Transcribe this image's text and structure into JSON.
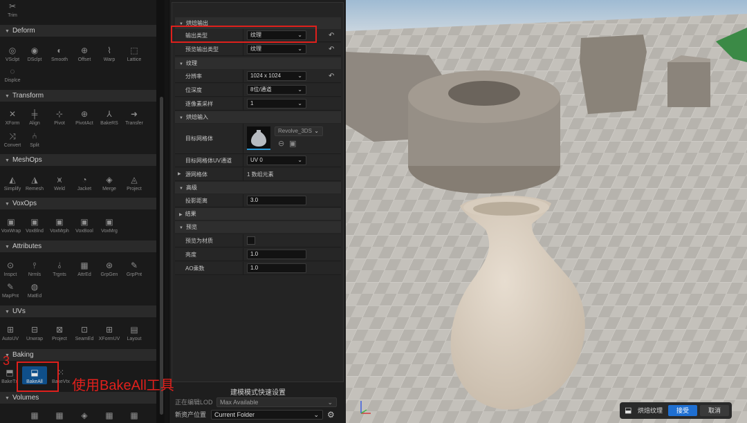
{
  "palette": {
    "sections": [
      {
        "title": "Deform",
        "tools": [
          "VSclpt",
          "DSclpt",
          "Smooth",
          "Offset",
          "Warp",
          "Lattice",
          "Displce"
        ]
      },
      {
        "title": "Transform",
        "tools": [
          "XForm",
          "Align",
          "Pivot",
          "PivotAct",
          "BakeRS",
          "Transfer",
          "Convert",
          "Split"
        ]
      },
      {
        "title": "MeshOps",
        "tools": [
          "Simplify",
          "Remesh",
          "Weld",
          "Jacket",
          "Merge",
          "Project"
        ]
      },
      {
        "title": "VoxOps",
        "tools": [
          "VoxWrap",
          "VoxBlnd",
          "VoxMrph",
          "VoxBool",
          "VoxMrg"
        ]
      },
      {
        "title": "Attributes",
        "tools": [
          "Inspct",
          "Nrmls",
          "Trgnts",
          "AttrEd",
          "GrpGen",
          "GrpPnt",
          "MapPnt",
          "MatEd"
        ]
      },
      {
        "title": "UVs",
        "tools": [
          "AutoUV",
          "Unwrap",
          "Project",
          "SeamEd",
          "XFormUV",
          "Layout"
        ]
      },
      {
        "title": "Baking",
        "tools": [
          "BakeTx",
          "BakeAll",
          "BakeVtx"
        ]
      },
      {
        "title": "Volumes",
        "tools": []
      }
    ],
    "top_tool": "Trim"
  },
  "details": {
    "cat_output": "烘焙输出",
    "output_type_label": "输出类型",
    "output_type_value": "纹理",
    "preview_output_label": "预览输出类型",
    "preview_output_value": "纹理",
    "cat_texture": "纹理",
    "resolution_label": "分辨率",
    "resolution_value": "1024 x 1024",
    "bitdepth_label": "位深度",
    "bitdepth_value": "8位/通道",
    "samples_label": "逐像素采样",
    "samples_value": "1",
    "cat_input": "烘焙输入",
    "target_mesh_label": "目标网格体",
    "target_mesh_value": "Revolve_3DS",
    "target_uv_label": "目标网格体UV通道",
    "target_uv_value": "UV 0",
    "source_mesh_label": "源网格体",
    "source_mesh_value": "1 数组元素",
    "cat_advanced": "高级",
    "projection_label": "投影距离",
    "projection_value": "3.0",
    "cat_results": "结果",
    "cat_preview": "预览",
    "preview_material_label": "预览为材质",
    "brightness_label": "亮度",
    "brightness_value": "1.0",
    "ao_label": "AO乘数",
    "ao_value": "1.0"
  },
  "footer": {
    "title": "建模模式快速设置",
    "lod_label": "正在编辑LOD",
    "lod_value": "Max Available",
    "asset_label": "新资产位置",
    "asset_value": "Current Folder"
  },
  "bake_toolbar": {
    "label": "烘焙纹理",
    "accept": "接受",
    "cancel": "取消"
  },
  "annotations": {
    "step": "3",
    "note": "使用BakeAll工具"
  },
  "colors": {
    "accent": "#1f6fd1",
    "annotation": "#e0201c",
    "active_tool": "#0f4f8a"
  }
}
